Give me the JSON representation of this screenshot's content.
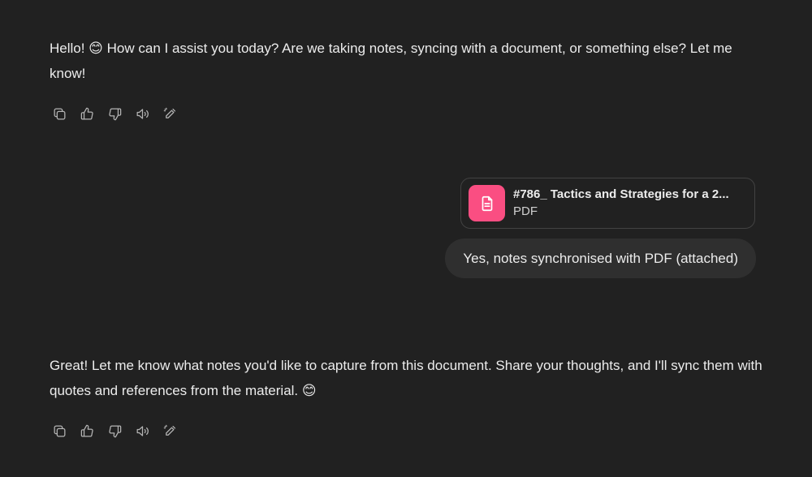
{
  "messages": [
    {
      "role": "assistant",
      "text": "Hello! 😊 How can I assist you today? Are we taking notes, syncing with a document, or something else? Let me know!"
    },
    {
      "role": "assistant",
      "text": "Great! Let me know what notes you'd like to capture from this document. Share your thoughts, and I'll sync them with quotes and references from the material. 😊"
    }
  ],
  "attachment": {
    "name": "#786_ Tactics and Strategies for a 2...",
    "type": "PDF",
    "icon": "document-icon",
    "icon_color": "#fa4e82"
  },
  "user_message": {
    "text": "Yes, notes synchronised with PDF (attached)"
  },
  "action_icons": [
    "copy-icon",
    "thumbs-up-icon",
    "thumbs-down-icon",
    "read-aloud-icon",
    "edit-icon"
  ],
  "colors": {
    "background": "#212121",
    "bubble": "#2f2f2f",
    "text": "#ececec",
    "icon": "#b4b4b4"
  }
}
